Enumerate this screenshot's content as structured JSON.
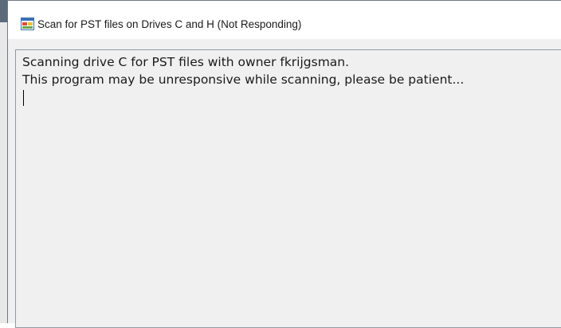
{
  "window": {
    "title": "Scan for PST files on Drives C and H (Not Responding)",
    "icon": "windows-form-app-icon"
  },
  "output": {
    "lines": [
      "Scanning drive C for PST files with owner fkrijgsman.",
      "This program may be unresponsive while scanning, please be patient..."
    ]
  }
}
